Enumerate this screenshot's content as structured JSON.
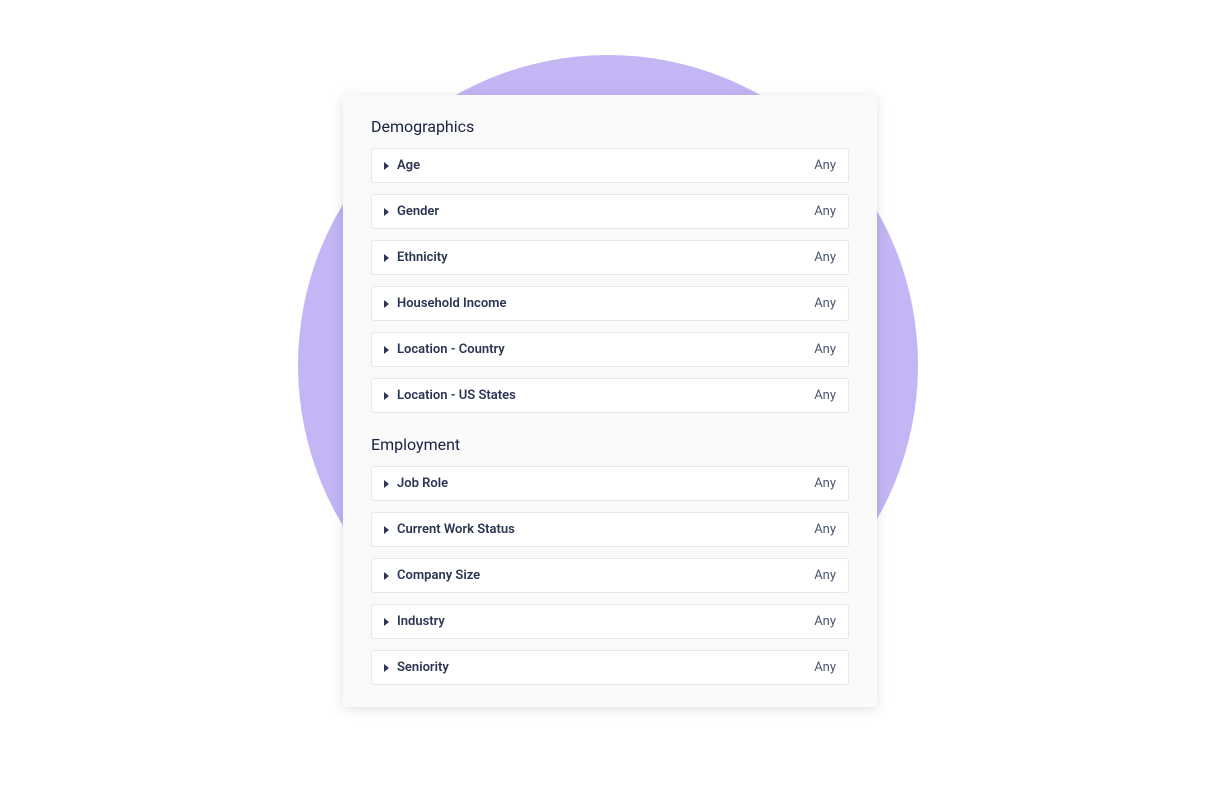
{
  "sections": [
    {
      "title": "Demographics",
      "name": "demographics",
      "filters": [
        {
          "label": "Age",
          "value": "Any",
          "name": "age"
        },
        {
          "label": "Gender",
          "value": "Any",
          "name": "gender"
        },
        {
          "label": "Ethnicity",
          "value": "Any",
          "name": "ethnicity"
        },
        {
          "label": "Household Income",
          "value": "Any",
          "name": "household-income"
        },
        {
          "label": "Location - Country",
          "value": "Any",
          "name": "location-country"
        },
        {
          "label": "Location - US States",
          "value": "Any",
          "name": "location-us-states"
        }
      ]
    },
    {
      "title": "Employment",
      "name": "employment",
      "filters": [
        {
          "label": "Job Role",
          "value": "Any",
          "name": "job-role"
        },
        {
          "label": "Current Work Status",
          "value": "Any",
          "name": "current-work-status"
        },
        {
          "label": "Company Size",
          "value": "Any",
          "name": "company-size"
        },
        {
          "label": "Industry",
          "value": "Any",
          "name": "industry"
        },
        {
          "label": "Seniority",
          "value": "Any",
          "name": "seniority"
        }
      ]
    }
  ]
}
